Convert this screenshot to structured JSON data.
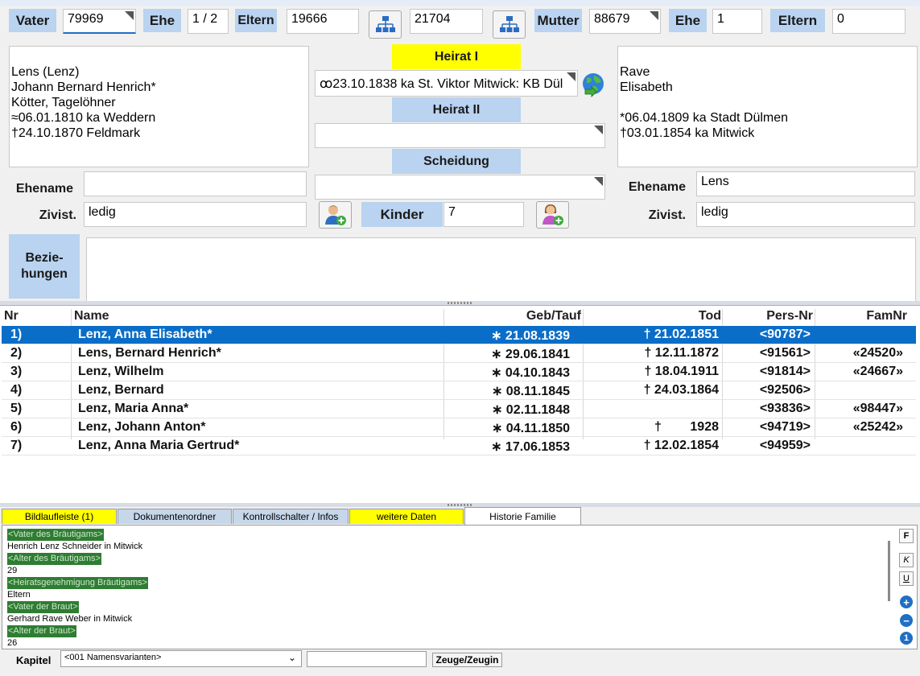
{
  "header": {
    "vater_label": "Vater",
    "vater_value": "79969",
    "ehe_label_1": "Ehe",
    "ehe_value_1": "1 / 2",
    "eltern_label_1": "Eltern",
    "eltern_value_1": "19666",
    "family_id": "21704",
    "mutter_label": "Mutter",
    "mutter_value": "88679",
    "ehe_label_2": "Ehe",
    "ehe_value_2": "1",
    "eltern_label_2": "Eltern",
    "eltern_value_2": "0"
  },
  "husband": {
    "lines": [
      "Lens (Lenz)",
      "Johann Bernard Henrich*",
      "Kötter, Tagelöhner",
      "≈06.01.1810 ka Weddern",
      "†24.10.1870 Feldmark"
    ],
    "ehename_label": "Ehename",
    "ehename_value": "",
    "zivist_label": "Zivist.",
    "zivist_value": "ledig"
  },
  "wife": {
    "lines": [
      "Rave",
      "Elisabeth",
      "",
      "*06.04.1809 ka Stadt Dülmen",
      "†03.01.1854 ka Mitwick"
    ],
    "ehename_label": "Ehename",
    "ehename_value": "Lens",
    "zivist_label": "Zivist.",
    "zivist_value": "ledig"
  },
  "marriage": {
    "heirat1_label": "Heirat I",
    "heirat1_value": "ꝏ23.10.1838 ka St. Viktor Mitwick: KB Dül",
    "heirat2_label": "Heirat II",
    "heirat2_value": "",
    "scheidung_label": "Scheidung",
    "scheidung_value": "",
    "kinder_label": "Kinder",
    "kinder_value": "7"
  },
  "beziehungen": {
    "label_line1": "Bezie-",
    "label_line2": "hungen",
    "value": ""
  },
  "children_table": {
    "columns": [
      "Nr",
      "Name",
      "Geb/Tauf",
      "Tod",
      "Pers-Nr",
      "FamNr"
    ],
    "rows": [
      {
        "nr": "1)",
        "name": "Lenz, Anna Elisabeth*",
        "geb": "∗ 21.08.1839",
        "tod": "† 21.02.1851",
        "pers": "<90787>",
        "fam": ""
      },
      {
        "nr": "2)",
        "name": "Lens, Bernard Henrich*",
        "geb": "∗ 29.06.1841",
        "tod": "† 12.11.1872",
        "pers": "<91561>",
        "fam": "«24520»"
      },
      {
        "nr": "3)",
        "name": "Lenz, Wilhelm",
        "geb": "∗ 04.10.1843",
        "tod": "† 18.04.1911",
        "pers": "<91814>",
        "fam": "«24667»"
      },
      {
        "nr": "4)",
        "name": "Lenz, Bernard",
        "geb": "∗ 08.11.1845",
        "tod": "† 24.03.1864",
        "pers": "<92506>",
        "fam": ""
      },
      {
        "nr": "5)",
        "name": "Lenz, Maria Anna*",
        "geb": "∗ 02.11.1848",
        "tod": "",
        "pers": "<93836>",
        "fam": "«98447»"
      },
      {
        "nr": "6)",
        "name": "Lenz, Johann Anton*",
        "geb": "∗ 04.11.1850",
        "tod": "†        1928",
        "pers": "<94719>",
        "fam": "«25242»"
      },
      {
        "nr": "7)",
        "name": "Lenz, Anna Maria Gertrud*",
        "geb": "∗ 17.06.1853",
        "tod": "† 12.02.1854",
        "pers": "<94959>",
        "fam": ""
      }
    ],
    "selected_row": 0
  },
  "tabs": [
    {
      "label": "Bildlaufleiste (1)",
      "color": "#ffff00"
    },
    {
      "label": "Dokumentenordner",
      "color": "#c6d7ea"
    },
    {
      "label": "Kontrollschalter / Infos",
      "color": "#c6d7ea"
    },
    {
      "label": "weitere Daten",
      "color": "#ffff00"
    },
    {
      "label": "Historie Familie",
      "color": "#ffffff"
    }
  ],
  "notes": [
    {
      "tag": "<Vater des Bräutigams>",
      "text": "Henrich Lenz Schneider in Mitwick"
    },
    {
      "tag": "<Alter des Bräutigams>",
      "text": "29"
    },
    {
      "tag": "<Heiratsgenehmigung Bräutigams>",
      "text": "Eltern"
    },
    {
      "tag": "<Vater der Braut>",
      "text": "Gerhard Rave Weber in Mitwick"
    },
    {
      "tag": "<Alter der Braut>",
      "text": "26"
    }
  ],
  "format_buttons": {
    "bold": "F",
    "italic": "K",
    "underline": "U"
  },
  "footer": {
    "kapitel_label": "Kapitel",
    "kapitel_value": "<001 Namensvarianten>",
    "text_value": "",
    "zeuge_button": "Zeuge/Zeugin"
  },
  "colors": {
    "label_blue": "#b9d3f0",
    "heirat_yellow": "#ffff00",
    "selection": "#0a6ec8",
    "tag_green": "#2e7d32"
  }
}
